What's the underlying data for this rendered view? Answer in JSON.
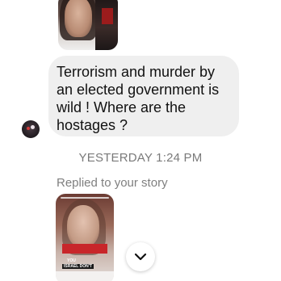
{
  "conversation": {
    "top_story_thumbnail": {
      "caption": "",
      "caption_bottom": ""
    },
    "message": {
      "text": "Terrorism and murder by an elected government is wild ! Where are the hostages ?"
    },
    "timestamp": "YESTERDAY 1:24 PM",
    "replied_label": "Replied to your story",
    "story_reply_thumbnail": {
      "label_you": "YOU",
      "label_israel": "ISRAEL DON'T"
    }
  },
  "scroll_button": {
    "icon": "chevron-down-icon"
  }
}
